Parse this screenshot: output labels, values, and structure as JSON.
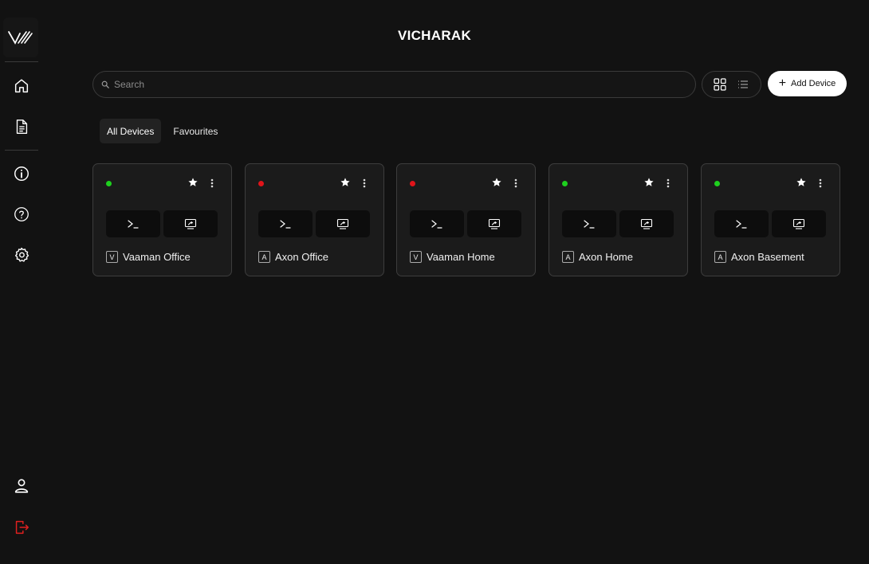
{
  "app": {
    "title": "VICHARAK"
  },
  "sidebar": {
    "logo": "vicharak-logo",
    "top_items": [
      {
        "icon": "home-icon"
      },
      {
        "icon": "document-icon"
      }
    ],
    "middle_items": [
      {
        "icon": "info-icon"
      },
      {
        "icon": "help-icon"
      },
      {
        "icon": "settings-gear-icon"
      }
    ],
    "bottom_items": [
      {
        "icon": "user-icon"
      },
      {
        "icon": "logout-icon",
        "color": "#e0201f"
      }
    ]
  },
  "search": {
    "placeholder": "Search",
    "value": ""
  },
  "view_toggle": {
    "options": [
      "grid-view-icon",
      "list-view-icon"
    ],
    "selected": "grid-view-icon"
  },
  "add_device": {
    "label": "Add Device"
  },
  "tabs": [
    {
      "label": "All Devices",
      "active": true
    },
    {
      "label": "Favourites",
      "active": false
    }
  ],
  "status_colors": {
    "online": "#1ed01e",
    "offline": "#e0141a"
  },
  "devices": [
    {
      "name": "Vaaman Office",
      "badge": "V",
      "status": "online"
    },
    {
      "name": "Axon Office",
      "badge": "A",
      "status": "offline"
    },
    {
      "name": "Vaaman Home",
      "badge": "V",
      "status": "offline"
    },
    {
      "name": "Axon Home",
      "badge": "A",
      "status": "online"
    },
    {
      "name": "Axon Basement",
      "badge": "A",
      "status": "online"
    }
  ]
}
